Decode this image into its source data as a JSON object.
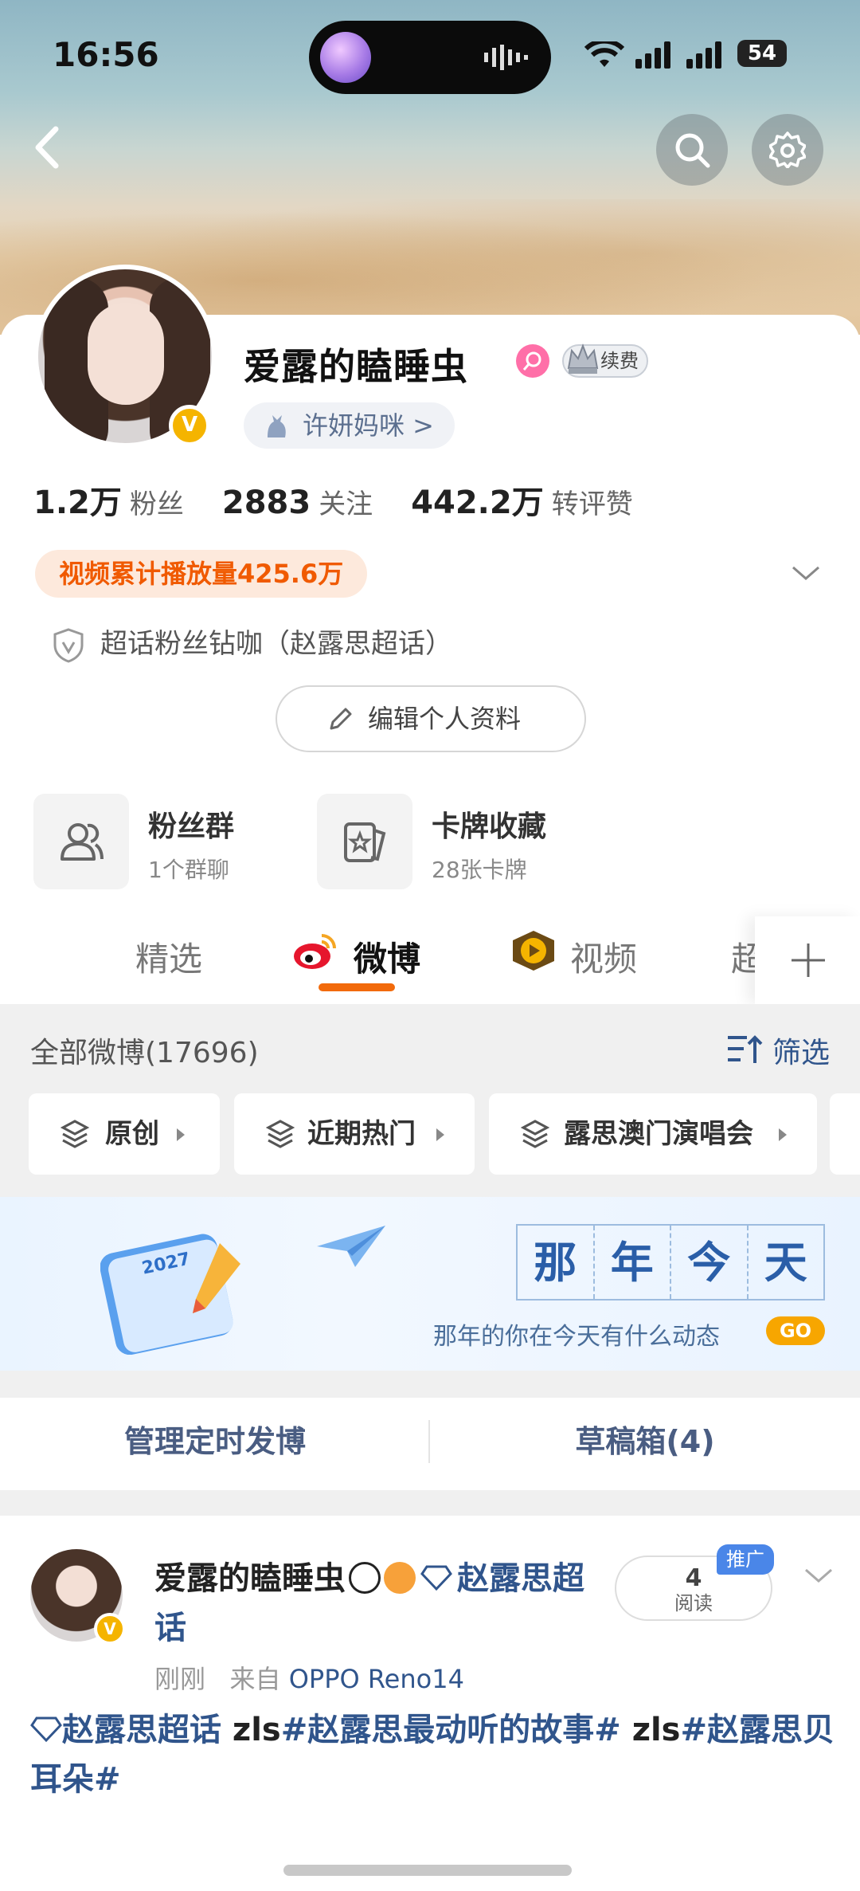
{
  "status_bar": {
    "time": "16:56",
    "battery": "54"
  },
  "profile": {
    "name": "爱露的瞌睡虫",
    "renew_label": "续费",
    "mom_label": "许妍妈咪 >",
    "stats": [
      {
        "num": "1.2万",
        "label": "粉丝"
      },
      {
        "num": "2883",
        "label": "关注"
      },
      {
        "num": "442.2万",
        "label": "转评赞"
      }
    ],
    "play_tag": "视频累计播放量425.6万",
    "super_fan": "超话粉丝钻咖（赵露思超话）",
    "edit_label": "编辑个人资料"
  },
  "features": [
    {
      "title": "粉丝群",
      "sub": "1个群聊"
    },
    {
      "title": "卡牌收藏",
      "sub": "28张卡牌"
    }
  ],
  "tabs": [
    "精选",
    "微博",
    "视频",
    "超"
  ],
  "feed": {
    "all_label": "全部微博(17696)",
    "filter_label": "筛选",
    "chips": [
      "原创",
      "近期热门",
      "露思澳门演唱会"
    ]
  },
  "banner": {
    "calendar_year": "2027",
    "title_chars": [
      "那",
      "年",
      "今",
      "天"
    ],
    "subtitle": "那年的你在今天有什么动态",
    "go_label": "GO"
  },
  "manage": {
    "scheduled": "管理定时发博",
    "drafts": "草稿箱(4)"
  },
  "post": {
    "author": "爱露的瞌睡虫",
    "topic": "赵露思超话",
    "time": "刚刚",
    "source_prefix": "来自",
    "device": "OPPO Reno14",
    "read_count": "4",
    "read_label": "阅读",
    "promo_label": "推广",
    "text_topic": "赵露思超话",
    "text_rest_1": " zls",
    "text_tag_1": "#赵露思最动听的故事#",
    "text_rest_2": " zls",
    "text_tag_2": "#赵露思贝耳朵#"
  },
  "colors": {
    "accent_orange": "#f26a0b",
    "link_blue": "#30558c",
    "vip_gold": "#f5b400"
  }
}
